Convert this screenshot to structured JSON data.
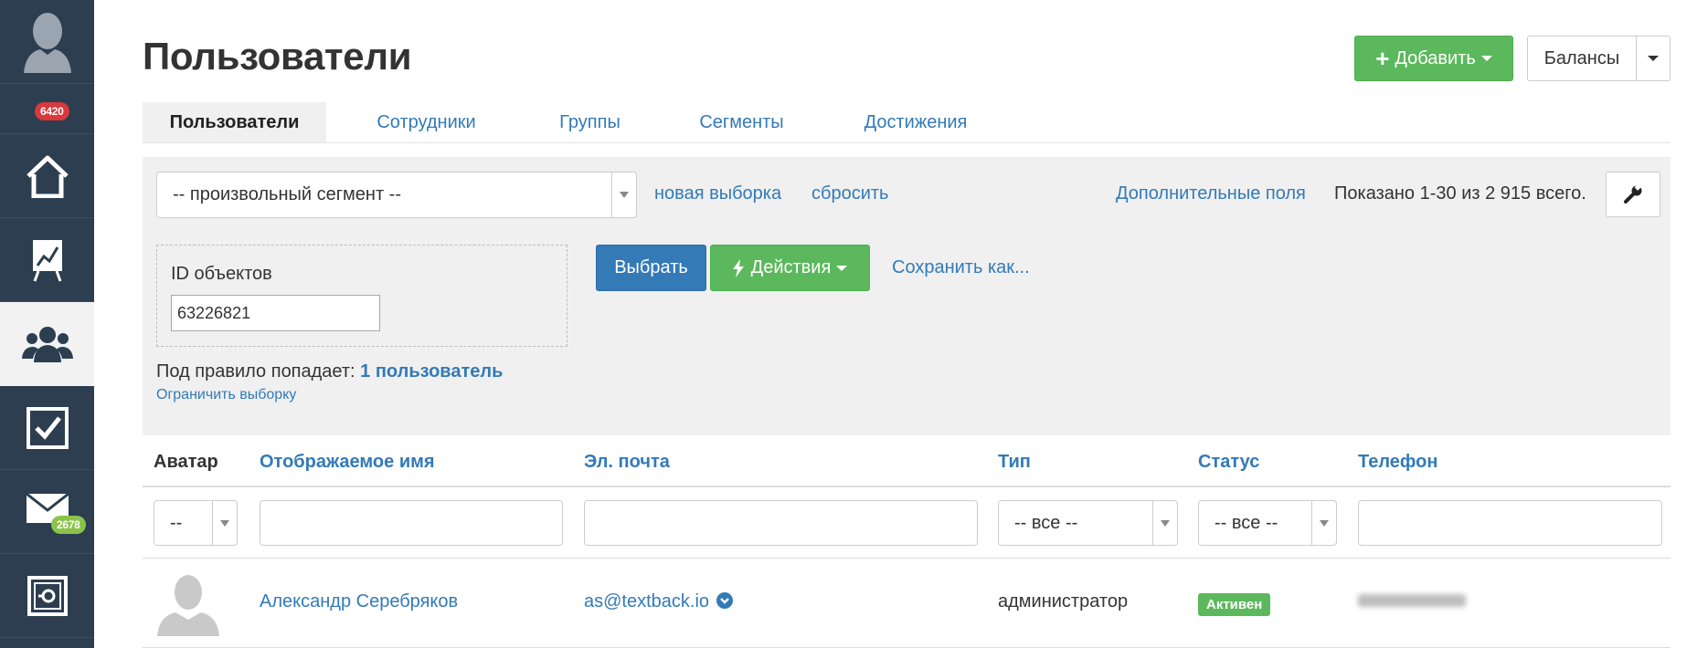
{
  "sidebar": {
    "badges": {
      "notifications": "6420",
      "messages": "2678"
    },
    "colors": {
      "bg": "#2c3e50",
      "badge_red": "#d9383c",
      "badge_green": "#8bc34a"
    },
    "icons": [
      "avatar-icon",
      "home-icon",
      "chart-board-icon",
      "users-icon",
      "checkbox-icon",
      "mail-icon",
      "safe-icon"
    ]
  },
  "header": {
    "title": "Пользователи",
    "add_label": "Добавить",
    "balances_label": "Балансы"
  },
  "tabs": [
    {
      "label": "Пользователи",
      "active": true
    },
    {
      "label": "Сотрудники",
      "active": false
    },
    {
      "label": "Группы",
      "active": false
    },
    {
      "label": "Сегменты",
      "active": false
    },
    {
      "label": "Достижения",
      "active": false
    }
  ],
  "filter": {
    "segment_value": "-- произвольный сегмент --",
    "new_selection": "новая выборка",
    "reset": "сбросить",
    "extra_fields": "Дополнительные поля",
    "shown": "Показано 1-30 из 2 915 всего.",
    "ids_label": "ID объектов",
    "ids_value": "63226821",
    "select_btn": "Выбрать",
    "actions_btn": "Действия",
    "save_as": "Сохранить как...",
    "rule_prefix": "Под правило попадает:",
    "rule_count": "1 пользователь",
    "limit": "Ограничить выборку"
  },
  "table": {
    "columns": {
      "avatar": "Аватар",
      "name": "Отображаемое имя",
      "email": "Эл. почта",
      "type": "Тип",
      "status": "Статус",
      "phone": "Телефон"
    },
    "filters": {
      "avatar": "--",
      "type": "-- все --",
      "status": "-- все --"
    },
    "rows": [
      {
        "name": "Александр Серебряков",
        "email": "as@textback.io",
        "type": "администратор",
        "status": "Активен"
      }
    ]
  }
}
